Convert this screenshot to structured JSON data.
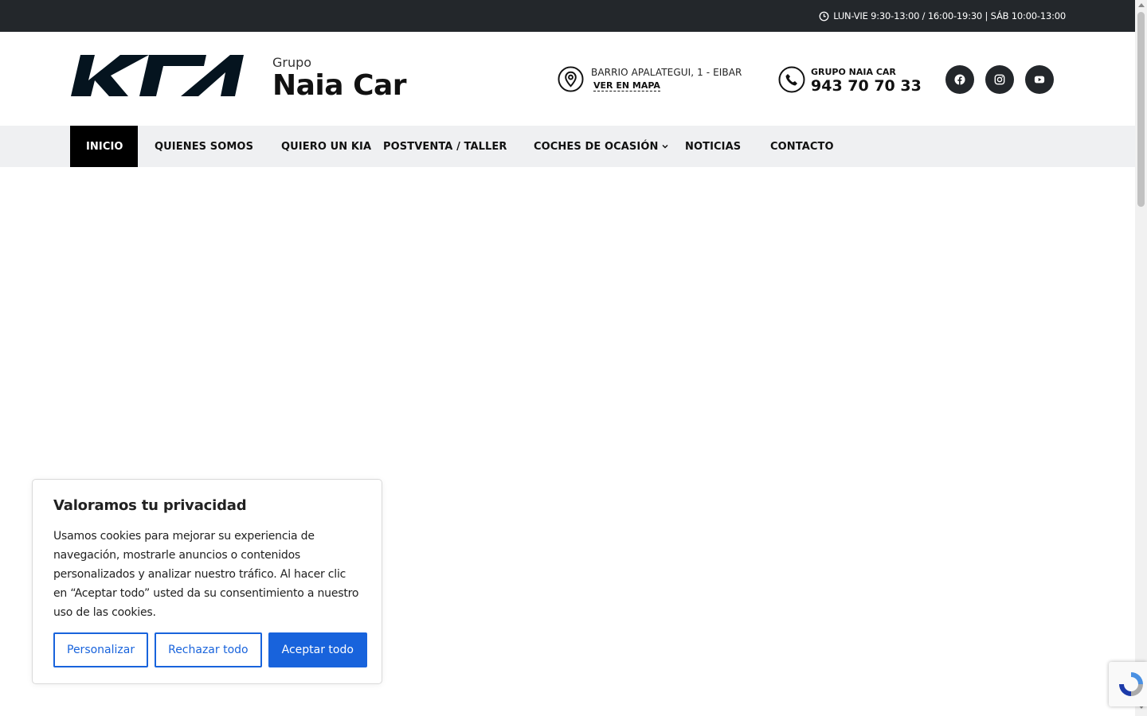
{
  "topbar": {
    "hours": "LUN-VIE 9:30-13:00 / 16:00-19:30 | SÁB 10:00-13:00",
    "icon": "clock-icon"
  },
  "header": {
    "logo": "KIA",
    "brand_prefix": "Grupo",
    "brand_name": "Naia Car",
    "address": "BARRIO APALATEGUI, 1 - EIBAR",
    "map_link": "VER EN MAPA",
    "phone_label": "GRUPO NAIA CAR",
    "phone_number": "943 70 70 33",
    "social": [
      "facebook-icon",
      "instagram-icon",
      "youtube-icon"
    ]
  },
  "nav": {
    "items": [
      {
        "label": "INICIO",
        "active": true
      },
      {
        "label": "QUIENES SOMOS",
        "active": false
      },
      {
        "label": "QUIERO UN KIA",
        "active": false
      },
      {
        "label": "POSTVENTA / TALLER",
        "active": false
      },
      {
        "label": "COCHES DE OCASIÓN",
        "active": false,
        "dropdown": true
      },
      {
        "label": "NOTICIAS",
        "active": false
      },
      {
        "label": "CONTACTO",
        "active": false
      }
    ]
  },
  "cookie": {
    "title": "Valoramos tu privacidad",
    "text": "Usamos cookies para mejorar su experiencia de navegación, mostrarle anuncios o contenidos personalizados y analizar nuestro tráfico. Al hacer clic en “Aceptar todo” usted da su consentimiento a nuestro uso de las cookies.",
    "customize": "Personalizar",
    "reject": "Rechazar todo",
    "accept": "Aceptar todo"
  },
  "colors": {
    "topbar": "#23272b",
    "nav_bg": "#eff0f2",
    "active": "#000000",
    "button_blue": "#1863dc"
  }
}
